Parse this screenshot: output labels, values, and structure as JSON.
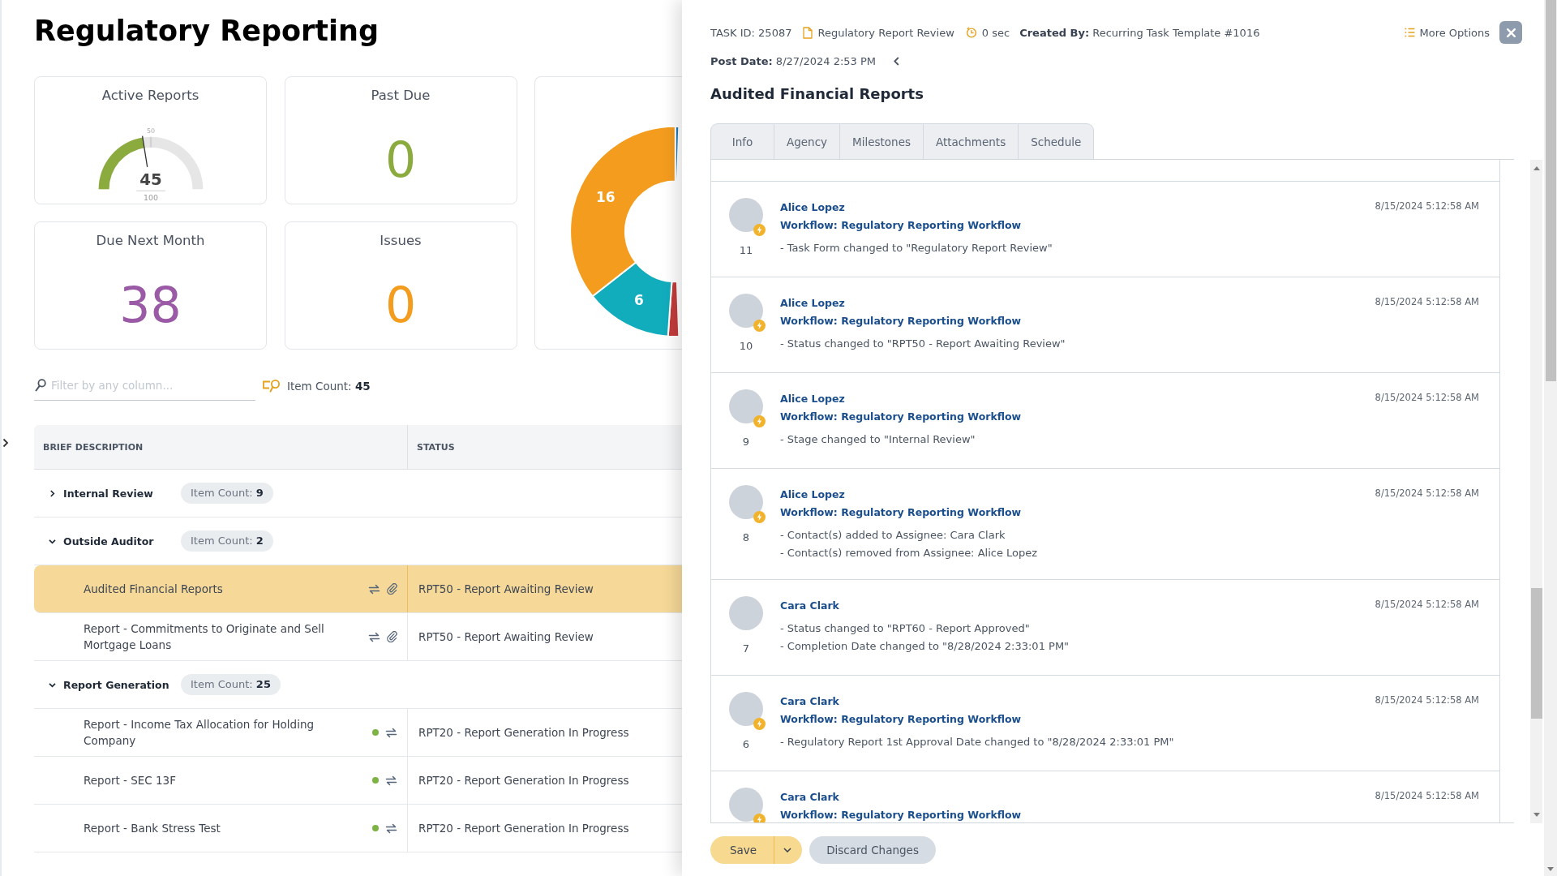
{
  "page": {
    "title": "Regulatory Reporting"
  },
  "cards": [
    {
      "kind": "gauge",
      "title": "Active Reports",
      "value": "45",
      "level": 0.45,
      "tick": "50",
      "max": "100"
    },
    {
      "kind": "number",
      "title": "Past Due",
      "value": "0",
      "color": "#8bab3f"
    },
    {
      "kind": "number",
      "title": "Due Next Month",
      "value": "38",
      "color": "#9a5aa6"
    },
    {
      "kind": "number",
      "title": "Issues",
      "value": "0",
      "color": "#f49c1e"
    }
  ],
  "status_chart": {
    "slices": [
      {
        "color": "#1f78b4"
      },
      {
        "color": "#c23b3b"
      },
      {
        "color": "#12adbd",
        "label": "6"
      },
      {
        "color": "#f49c1e",
        "label": "16"
      }
    ]
  },
  "filter": {
    "placeholder": "Filter by any column...",
    "item_count": "Item Count: **45**"
  },
  "table": {
    "columns": [
      "BRIEF DESCRIPTION",
      "STATUS"
    ],
    "groups": [
      {
        "name": "Internal Review",
        "count": "Item Count: **9**",
        "expanded": false
      },
      {
        "name": "Outside Auditor",
        "count": "Item Count: **2**",
        "expanded": true,
        "rows": [
          {
            "description": "Audited Financial Reports",
            "status": "RPT50 - Report Awaiting Review",
            "selected": true,
            "recurring": true,
            "attachment": true
          },
          {
            "description": "Report - Commitments to Originate and Sell Mortgage Loans",
            "status": "RPT50 - Report Awaiting Review",
            "selected": false,
            "recurring": true,
            "attachment": true
          }
        ]
      },
      {
        "name": "Report Generation",
        "count": "Item Count: **25**",
        "expanded": true,
        "rows": [
          {
            "description": "Report - Income Tax Allocation for Holding Company",
            "status": "RPT20 - Report Generation In Progress",
            "selected": false,
            "recurring": true,
            "attachment": false,
            "color": "#7cb342"
          },
          {
            "description": "Report - SEC 13F",
            "status": "RPT20 - Report Generation In Progress",
            "selected": false,
            "recurring": true,
            "attachment": false,
            "color": "#7cb342"
          },
          {
            "description": "Report - Bank Stress Test",
            "status": "RPT20 - Report Generation In Progress",
            "selected": false,
            "recurring": true,
            "attachment": false,
            "color": "#7cb342"
          }
        ]
      }
    ]
  },
  "panel": {
    "task_id": "TASK ID: 25087",
    "form": "Regulatory Report Review",
    "duration": "0 sec",
    "created_by": "**Created By:** Recurring Task Template #1016",
    "more_options": "More Options",
    "post_date": "**Post Date:** 8/27/2024 2:53 PM",
    "title": "Audited Financial Reports",
    "tabs": [
      {
        "label": "Info",
        "selected": false
      },
      {
        "label": "Agency",
        "selected": false
      },
      {
        "label": "Milestones",
        "selected": false
      },
      {
        "label": "Attachments",
        "selected": false
      },
      {
        "label": "Schedule",
        "selected": false
      }
    ],
    "history": [
      {
        "user": "Alice Lopez",
        "workflow": "Workflow: Regulatory Reporting Workflow",
        "automated": true,
        "number": "11",
        "time": "8/15/2024 5:12:58 AM",
        "changes": [
          "- Task Form changed to \"Regulatory Report Review\""
        ]
      },
      {
        "user": "Alice Lopez",
        "workflow": "Workflow: Regulatory Reporting Workflow",
        "automated": true,
        "number": "10",
        "time": "8/15/2024 5:12:58 AM",
        "changes": [
          "- Status changed to \"RPT50 - Report Awaiting Review\""
        ]
      },
      {
        "user": "Alice Lopez",
        "workflow": "Workflow: Regulatory Reporting Workflow",
        "automated": true,
        "number": "9",
        "time": "8/15/2024 5:12:58 AM",
        "changes": [
          "- Stage changed to \"Internal Review\""
        ]
      },
      {
        "user": "Alice Lopez",
        "workflow": "Workflow: Regulatory Reporting Workflow",
        "automated": true,
        "number": "8",
        "time": "8/15/2024 5:12:58 AM",
        "changes": [
          "- Contact(s) added to Assignee: Cara Clark",
          "- Contact(s) removed from Assignee: Alice Lopez"
        ]
      },
      {
        "user": "Cara Clark",
        "automated": false,
        "number": "7",
        "time": "8/15/2024 5:12:58 AM",
        "changes": [
          "- Status changed to \"RPT60 - Report Approved\"",
          "- Completion Date changed to \"8/28/2024 2:33:01 PM\""
        ]
      },
      {
        "user": "Cara Clark",
        "workflow": "Workflow: Regulatory Reporting Workflow",
        "automated": true,
        "number": "6",
        "time": "8/15/2024 5:12:58 AM",
        "changes": [
          "- Regulatory Report 1st Approval Date changed to \"8/28/2024 2:33:01 PM\""
        ]
      },
      {
        "user": "Cara Clark",
        "workflow": "Workflow: Regulatory Reporting Workflow",
        "automated": true,
        "time": "8/15/2024 5:12:58 AM"
      }
    ],
    "save": "Save",
    "discard": "Discard Changes"
  }
}
